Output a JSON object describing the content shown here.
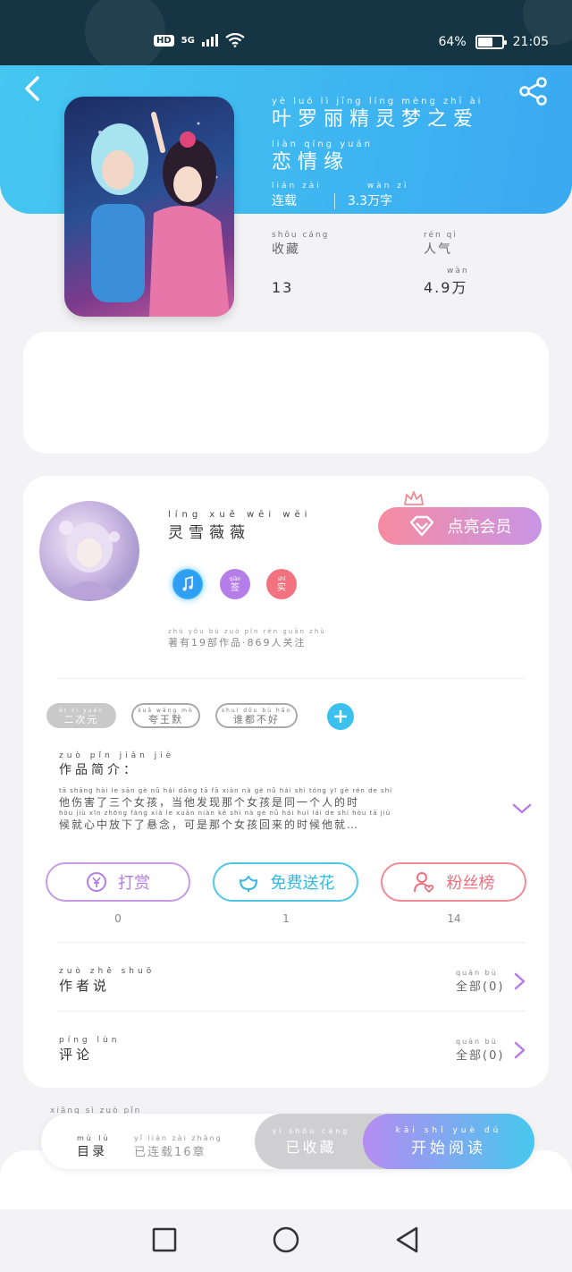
{
  "status_bar": {
    "hd": "HD",
    "network": "5G",
    "battery_pct": "64%",
    "battery_level": 0.64,
    "time": "21:05"
  },
  "book": {
    "title_pinyin": "yè luó lì jīng líng mèng zhī ài",
    "title_line1": "叶罗丽精灵梦之爱",
    "title_line2_pinyin": "liàn qíng yuán",
    "title_line2": "恋情缘",
    "status_pinyin": "lián zài",
    "status": "连载",
    "wordcount_pinyin": "wàn zì",
    "wordcount": "3.3万字",
    "collect_pinyin": "shōu cáng",
    "collect_label": "收藏",
    "collect_value": "13",
    "popularity_pinyin": "rén qì",
    "popularity_label": "人气",
    "popularity_value_pinyin": "wàn",
    "popularity_value": "4.9万"
  },
  "author": {
    "name_pinyin": "líng xuě wēi wēi",
    "name": "灵雪薇薇",
    "vip_label": "点亮会员",
    "badge_sign_pinyin": "qiān",
    "badge_sign": "签",
    "badge_real_pinyin": "shí",
    "badge_real": "实",
    "works_pinyin": "zhù yǒu    bù zuò pǐn      rén guān zhù",
    "works": "著有19部作品·869人关注"
  },
  "tags": [
    {
      "pinyin": "èr cì yuán",
      "label": "二次元"
    },
    {
      "pinyin": "kuā wáng mò",
      "label": "夸王默"
    },
    {
      "pinyin": "shuí dōu bù hǎo",
      "label": "谁都不好"
    }
  ],
  "intro": {
    "title_pinyin": "zuò pǐn jiǎn jiè",
    "title": "作品简介：",
    "line1_pinyin": "tā shāng hài le sān gè nǚ hái dāng tā fā xiàn nà gè nǚ hái shì tóng yī gè rén de shí",
    "line1": "他伤害了三个女孩，当他发现那个女孩是同一个人的时",
    "line2_pinyin": "hòu jiù xīn zhōng fàng xià le xuán niàn kě shì nà gè nǚ hái huí lái de shí hòu tā jiù",
    "line2": "候就心中放下了悬念，可是那个女孩回来的时候他就…"
  },
  "actions": {
    "tip_label": "打赏",
    "tip_count": "0",
    "flower_label": "免费送花",
    "flower_count": "1",
    "fans_label": "粉丝榜",
    "fans_count": "14"
  },
  "author_says": {
    "pinyin": "zuò zhě shuō",
    "label": "作者说",
    "more_pinyin": "quán bù",
    "more": "全部(0)"
  },
  "comments": {
    "pinyin": "píng lùn",
    "label": "评论",
    "more_pinyin": "quán bù",
    "more": "全部(0)"
  },
  "bottom": {
    "toc_pinyin": "mù lù",
    "toc": "目录",
    "toc_status_pinyin": "yǐ lián zài   zhāng",
    "toc_status": "已连载16章",
    "partial_pinyin": "xiāng sì zuò pǐn",
    "collected_pinyin": "yǐ shōu cáng",
    "collected": "已收藏",
    "read_pinyin": "kāi shǐ yuè dú",
    "read": "开始阅读"
  },
  "colors": {
    "header": "#3aa9f1",
    "accent_purple": "#b57de8",
    "accent_cyan": "#34b7e3",
    "accent_red": "#ee6f7e"
  }
}
